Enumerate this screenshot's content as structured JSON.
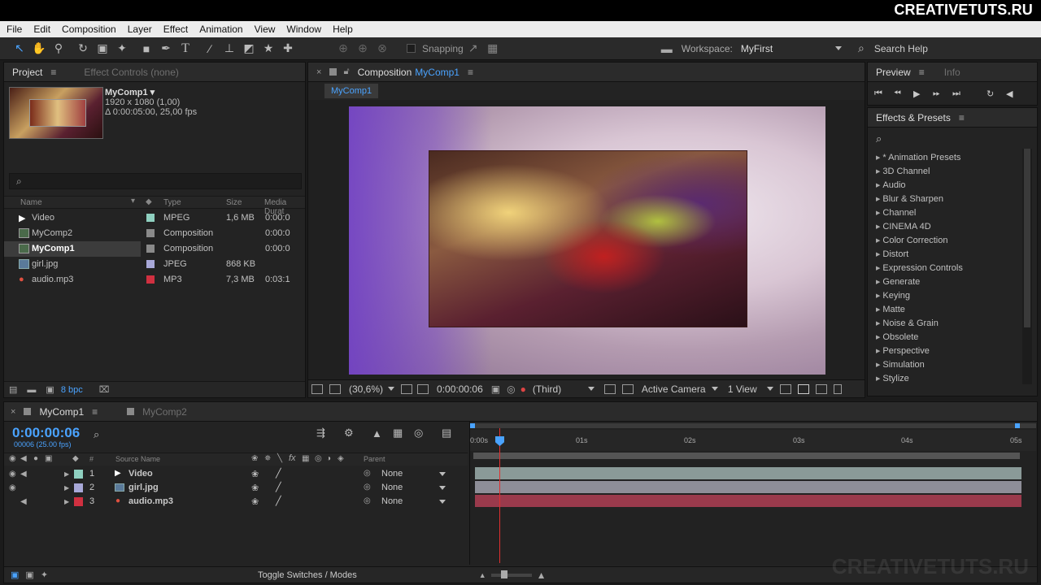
{
  "watermark": "CREATIVETUTS.RU",
  "menu": [
    "File",
    "Edit",
    "Composition",
    "Layer",
    "Effect",
    "Animation",
    "View",
    "Window",
    "Help"
  ],
  "toolbar": {
    "snapping_label": "Snapping",
    "workspace_label": "Workspace:",
    "workspace_value": "MyFirst",
    "search_help": "Search Help"
  },
  "project": {
    "tab_project": "Project",
    "tab_effect_controls": "Effect Controls (none)",
    "selected_name": "MyComp1 ▾",
    "selected_resolution": "1920 x 1080 (1,00)",
    "selected_duration": "Δ 0:00:05:00, 25,00 fps",
    "columns": {
      "name": "Name",
      "type": "Type",
      "size": "Size",
      "duration": "Media Durat"
    },
    "items": [
      {
        "name": "Video",
        "type": "MPEG",
        "size": "1,6 MB",
        "duration": "0:00:0",
        "color": "#8fd0c0",
        "icon": "video-icon"
      },
      {
        "name": "MyComp2",
        "type": "Composition",
        "size": "",
        "duration": "0:00:0",
        "color": "#8a8a8a",
        "icon": "composition-icon"
      },
      {
        "name": "MyComp1",
        "type": "Composition",
        "size": "",
        "duration": "0:00:0",
        "color": "#8a8a8a",
        "icon": "composition-icon"
      },
      {
        "name": "girl.jpg",
        "type": "JPEG",
        "size": "868 KB",
        "duration": "",
        "color": "#a8a8d8",
        "icon": "image-icon"
      },
      {
        "name": "audio.mp3",
        "type": "MP3",
        "size": "7,3 MB",
        "duration": "0:03:1",
        "color": "#d03040",
        "icon": "audio-icon"
      }
    ],
    "bpc": "8 bpc"
  },
  "composition": {
    "tab_prefix": "Composition",
    "tab_name": "MyComp1",
    "subtab": "MyComp1",
    "zoom": "(30,6%)",
    "timecode": "0:00:00:06",
    "resolution": "(Third)",
    "camera": "Active Camera",
    "view": "1 View"
  },
  "preview": {
    "tab_preview": "Preview",
    "tab_info": "Info"
  },
  "effects": {
    "title": "Effects & Presets",
    "items": [
      "* Animation Presets",
      "3D Channel",
      "Audio",
      "Blur & Sharpen",
      "Channel",
      "CINEMA 4D",
      "Color Correction",
      "Distort",
      "Expression Controls",
      "Generate",
      "Keying",
      "Matte",
      "Noise & Grain",
      "Obsolete",
      "Perspective",
      "Simulation",
      "Stylize"
    ]
  },
  "timeline": {
    "tab_active": "MyComp1",
    "tab_other": "MyComp2",
    "timecode": "0:00:00:06",
    "fps": "00006 (25.00 fps)",
    "col_source": "Source Name",
    "col_parent": "Parent",
    "col_num": "#",
    "ticks": [
      "0:00s",
      "01s",
      "02s",
      "03s",
      "04s",
      "05s"
    ],
    "layers": [
      {
        "num": "1",
        "name": "Video",
        "parent": "None",
        "color": "#8fd0c0",
        "icon": "video-icon",
        "bar": "#8a9a98"
      },
      {
        "num": "2",
        "name": "girl.jpg",
        "parent": "None",
        "color": "#a8a8d8",
        "icon": "image-icon",
        "bar": "#8e8e98"
      },
      {
        "num": "3",
        "name": "audio.mp3",
        "parent": "None",
        "color": "#d03040",
        "icon": "audio-icon",
        "bar": "#9a3a4c"
      }
    ],
    "toggle_label": "Toggle Switches / Modes"
  }
}
